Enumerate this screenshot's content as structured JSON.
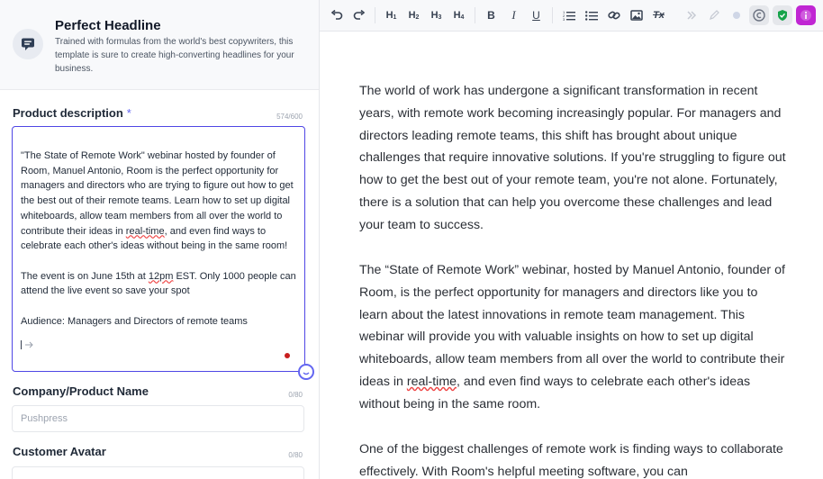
{
  "template": {
    "title": "Perfect Headline",
    "description": "Trained with formulas from the world's best copywriters, this template is sure to create high-converting headlines for your business.",
    "icon": "chat-bubble-icon"
  },
  "product_description": {
    "label": "Product description",
    "required_mark": "*",
    "counter": "574/600",
    "text_before_ideas": "\"The State of Remote Work\" webinar hosted by founder of Room, Manuel Antonio, Room is the perfect opportunity for managers and directors who are trying to figure out how to get the best out of their remote teams. Learn how to set up digital whiteboards, allow team members from all over the world to contribute their ideas in ",
    "squiggle_1": "real-time",
    "text_mid_1": ", and even find ways to celebrate each other's ideas without being in the same room!\n\nThe event is on June 15th at ",
    "squiggle_2": "12pm",
    "text_mid_2": " EST. Only 1000 people can attend the live event so save your spot\n\nAudience: Managers and Directors of remote teams"
  },
  "company_name": {
    "label": "Company/Product Name",
    "counter": "0/80",
    "placeholder": "Pushpress"
  },
  "customer_avatar": {
    "label": "Customer Avatar",
    "counter": "0/80"
  },
  "toolbar": {
    "undo_icon": "undo-icon",
    "redo_icon": "redo-icon",
    "h1": "H",
    "h1_sub": "1",
    "h2": "H",
    "h2_sub": "2",
    "h3": "H",
    "h3_sub": "3",
    "h4": "H",
    "h4_sub": "4",
    "bold": "B",
    "italic": "I",
    "underline": "U",
    "ordered_list_icon": "ordered-list-icon",
    "bullet_list_icon": "bullet-list-icon",
    "link_icon": "link-icon",
    "image_icon": "image-icon",
    "clear_format": "Tx"
  },
  "editor": {
    "paragraph_1": "The world of work has undergone a significant transformation in recent years, with remote work becoming increasingly popular. For managers and directors leading remote teams, this shift has brought about unique challenges that require innovative solutions. If you're struggling to figure out how to get the best out of your remote team, you're not alone. Fortunately, there is a solution that can help you overcome these challenges and lead your team to success.",
    "paragraph_2_before": "The “State of Remote Work” webinar, hosted by Manuel Antonio, founder of Room, is the perfect opportunity for managers and directors like you to learn about the latest innovations in remote team management. This webinar will provide you with valuable insights on how to set up digital whiteboards, allow team members from all over the world to contribute their ideas in ",
    "paragraph_2_squiggle": "real-time",
    "paragraph_2_after": ", and even find ways to celebrate each other's ideas without being in the same room.",
    "paragraph_3": "One of the biggest challenges of remote work is finding ways to collaborate effectively. With Room's helpful meeting software, you can"
  },
  "colors": {
    "accent": "#4f46e5",
    "shield_green": "#16a34a",
    "badge_magenta": "#c026d3"
  }
}
